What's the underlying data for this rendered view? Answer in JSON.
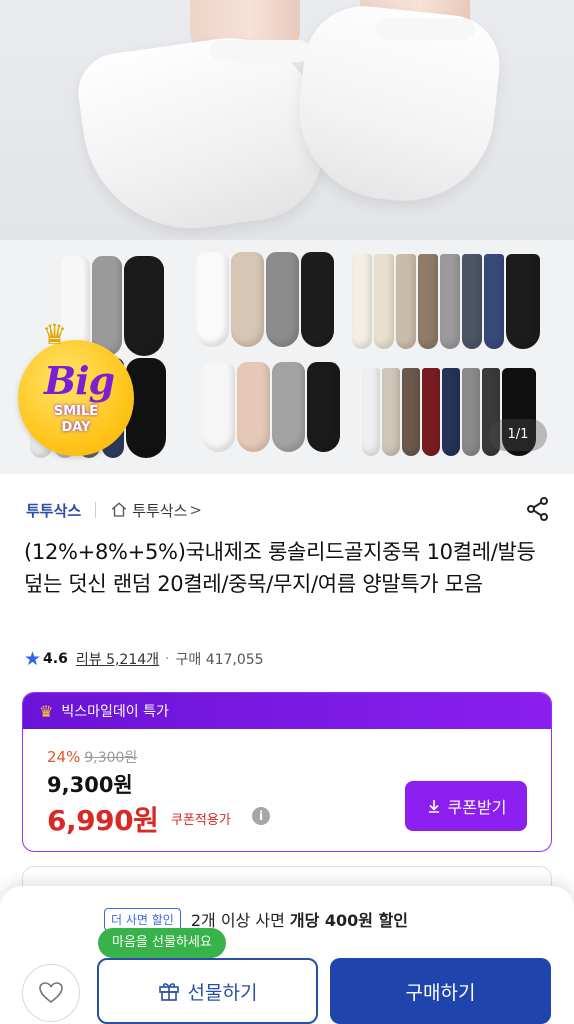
{
  "hero": {
    "badge": {
      "big": "Big",
      "line1": "SMILE",
      "line2": "DAY"
    },
    "page_indicator": "1/1"
  },
  "store": {
    "brand": "투투삭스",
    "store_name": "투투삭스",
    "chevron": ">"
  },
  "product": {
    "title": "(12%+8%+5%)국내제조 롱솔리드골지중목 10켤레/발등덮는 덧신 랜덤 20켤레/중목/무지/여름 양말특가 모음",
    "rating": "4.6",
    "reviews": "리뷰 5,214개",
    "purchases": "구매 417,055"
  },
  "price": {
    "promo_label": "빅스마일데이 특가",
    "discount_pct": "24%",
    "original_price": "9,300원",
    "price": "9,300원",
    "final_price": "6,990원",
    "coupon_applied_label": "쿠폰적용가",
    "coupon_button": "쿠폰받기"
  },
  "bottom": {
    "multi_tag": "더 사면 할인",
    "multi_text_prefix": "2개 이상 사면 ",
    "multi_text_bold": "개당 400원 할인",
    "gift_bubble": "마음을 선물하세요",
    "gift_button": "선물하기",
    "buy_button": "구매하기"
  },
  "colors": {
    "brand_blue": "#2a4ea6",
    "promo_purple": "#8a1ff0",
    "price_red": "#d72a25",
    "buy_blue": "#1f44ad",
    "gift_green": "#37b34a"
  }
}
